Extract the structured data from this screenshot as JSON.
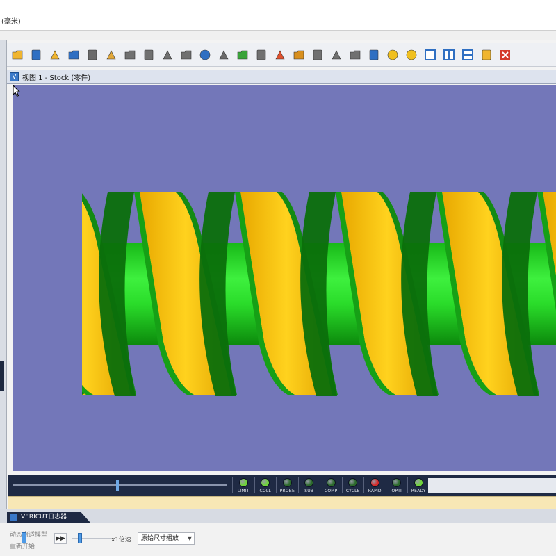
{
  "window": {
    "unit_label": "(毫米)"
  },
  "toolbar": {
    "icons": [
      {
        "name": "open-folder-icon",
        "color": "#f0b530"
      },
      {
        "name": "save-icon",
        "color": "#2f6fc2"
      },
      {
        "name": "open-project-icon",
        "color": "#f0b530"
      },
      {
        "name": "save-project-icon",
        "color": "#2f6fc2"
      },
      {
        "name": "tools-icon",
        "color": "#6a6a6a"
      },
      {
        "name": "folder-arrow-icon",
        "color": "#e2a83a"
      },
      {
        "name": "tool-list-icon",
        "color": "#707070"
      },
      {
        "name": "report-icon",
        "color": "#707070"
      },
      {
        "name": "machine-settings-icon",
        "color": "#707070"
      },
      {
        "name": "inspect-icon",
        "color": "#707070"
      },
      {
        "name": "info-icon",
        "color": "#2f6fc2"
      },
      {
        "name": "machine-icon",
        "color": "#6a6a6a"
      },
      {
        "name": "w-icon",
        "color": "#3aa33a"
      },
      {
        "name": "cut-icon",
        "color": "#707070"
      },
      {
        "name": "magnet-icon",
        "color": "#e0512d"
      },
      {
        "name": "measure-icon",
        "color": "#d88f1d"
      },
      {
        "name": "zoom-box-icon",
        "color": "#707070"
      },
      {
        "name": "zoom-in-icon",
        "color": "#707070"
      },
      {
        "name": "zoom-out-icon",
        "color": "#707070"
      },
      {
        "name": "fit-view-icon",
        "color": "#2f6fc2"
      },
      {
        "name": "sphere-icon",
        "color": "#f0c020"
      },
      {
        "name": "rotate-icon",
        "color": "#f0c020"
      },
      {
        "name": "single-view-icon",
        "color": "#2f6fc2"
      },
      {
        "name": "vertical-split-icon",
        "color": "#2f6fc2"
      },
      {
        "name": "horizontal-split-icon",
        "color": "#2f6fc2"
      },
      {
        "name": "reset-layout-icon",
        "color": "#f0b530"
      },
      {
        "name": "close-view-icon",
        "color": "#d43b2b"
      }
    ]
  },
  "view": {
    "title": "视图 1 - Stock (零件)",
    "background": "#7377b9"
  },
  "status": {
    "lights": [
      {
        "label": "LIMIT",
        "color": "#6fd43a"
      },
      {
        "label": "COLL",
        "color": "#6fd43a"
      },
      {
        "label": "PROBE",
        "color": "#2c6a2c"
      },
      {
        "label": "SUB",
        "color": "#2c6a2c"
      },
      {
        "label": "COMP",
        "color": "#2c6a2c"
      },
      {
        "label": "CYCLE",
        "color": "#2c6a2c"
      },
      {
        "label": "RAPID",
        "color": "#d62a2a"
      },
      {
        "label": "OPTI",
        "color": "#2c6a2c"
      },
      {
        "label": "READY",
        "color": "#6fd43a"
      }
    ]
  },
  "log_tab": {
    "label": "VERICUT日志器"
  },
  "bottom": {
    "text1": "动态自适模型",
    "text2": "重新开始",
    "speed_label": "x1倍速",
    "mode_select": "原始尺寸播放"
  }
}
